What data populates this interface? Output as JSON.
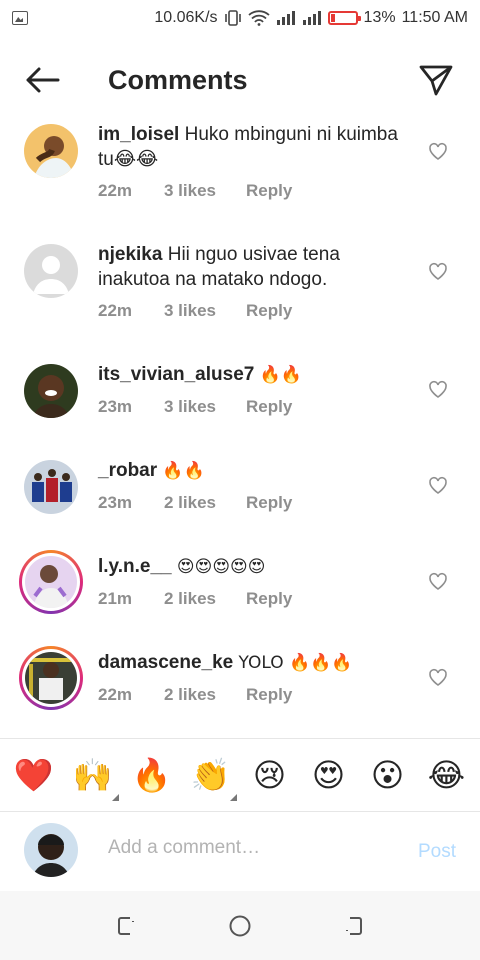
{
  "status_bar": {
    "speed": "10.06K/s",
    "battery_pct": "13%",
    "time": "11:50 AM",
    "battery_level": 0.13,
    "battery_color": "#e53935"
  },
  "header": {
    "title": "Comments"
  },
  "comments": [
    {
      "user": "im_loisel",
      "text": "Huko mbinguni ni kuimba tu😂😂",
      "time": "22m",
      "likes": "3 likes",
      "reply": "Reply",
      "story_ring": false
    },
    {
      "user": "njekika",
      "text": "Hii nguo usivae tena inakutoa na matako ndogo.",
      "time": "22m",
      "likes": "3 likes",
      "reply": "Reply",
      "story_ring": false
    },
    {
      "user": "its_vivian_aluse7",
      "text": "🔥🔥",
      "time": "23m",
      "likes": "3 likes",
      "reply": "Reply",
      "story_ring": false
    },
    {
      "user": "_robar",
      "text": "🔥🔥",
      "time": "23m",
      "likes": "2 likes",
      "reply": "Reply",
      "story_ring": false
    },
    {
      "user": "l.y.n.e__",
      "text": "😍😍😍😍😍",
      "time": "21m",
      "likes": "2 likes",
      "reply": "Reply",
      "story_ring": true
    },
    {
      "user": "damascene_ke",
      "text": "YOLO 🔥🔥🔥",
      "time": "22m",
      "likes": "2 likes",
      "reply": "Reply",
      "story_ring": true
    }
  ],
  "emoji_bar": [
    "❤️",
    "🙌",
    "🔥",
    "👏",
    "😢",
    "😍",
    "😮",
    "😂"
  ],
  "composer": {
    "placeholder": "Add a comment…",
    "post_label": "Post",
    "post_color": "#b3dbff"
  },
  "icons": {
    "back": "arrow-left-icon",
    "share": "paper-plane-icon",
    "like": "heart-outline-icon"
  }
}
